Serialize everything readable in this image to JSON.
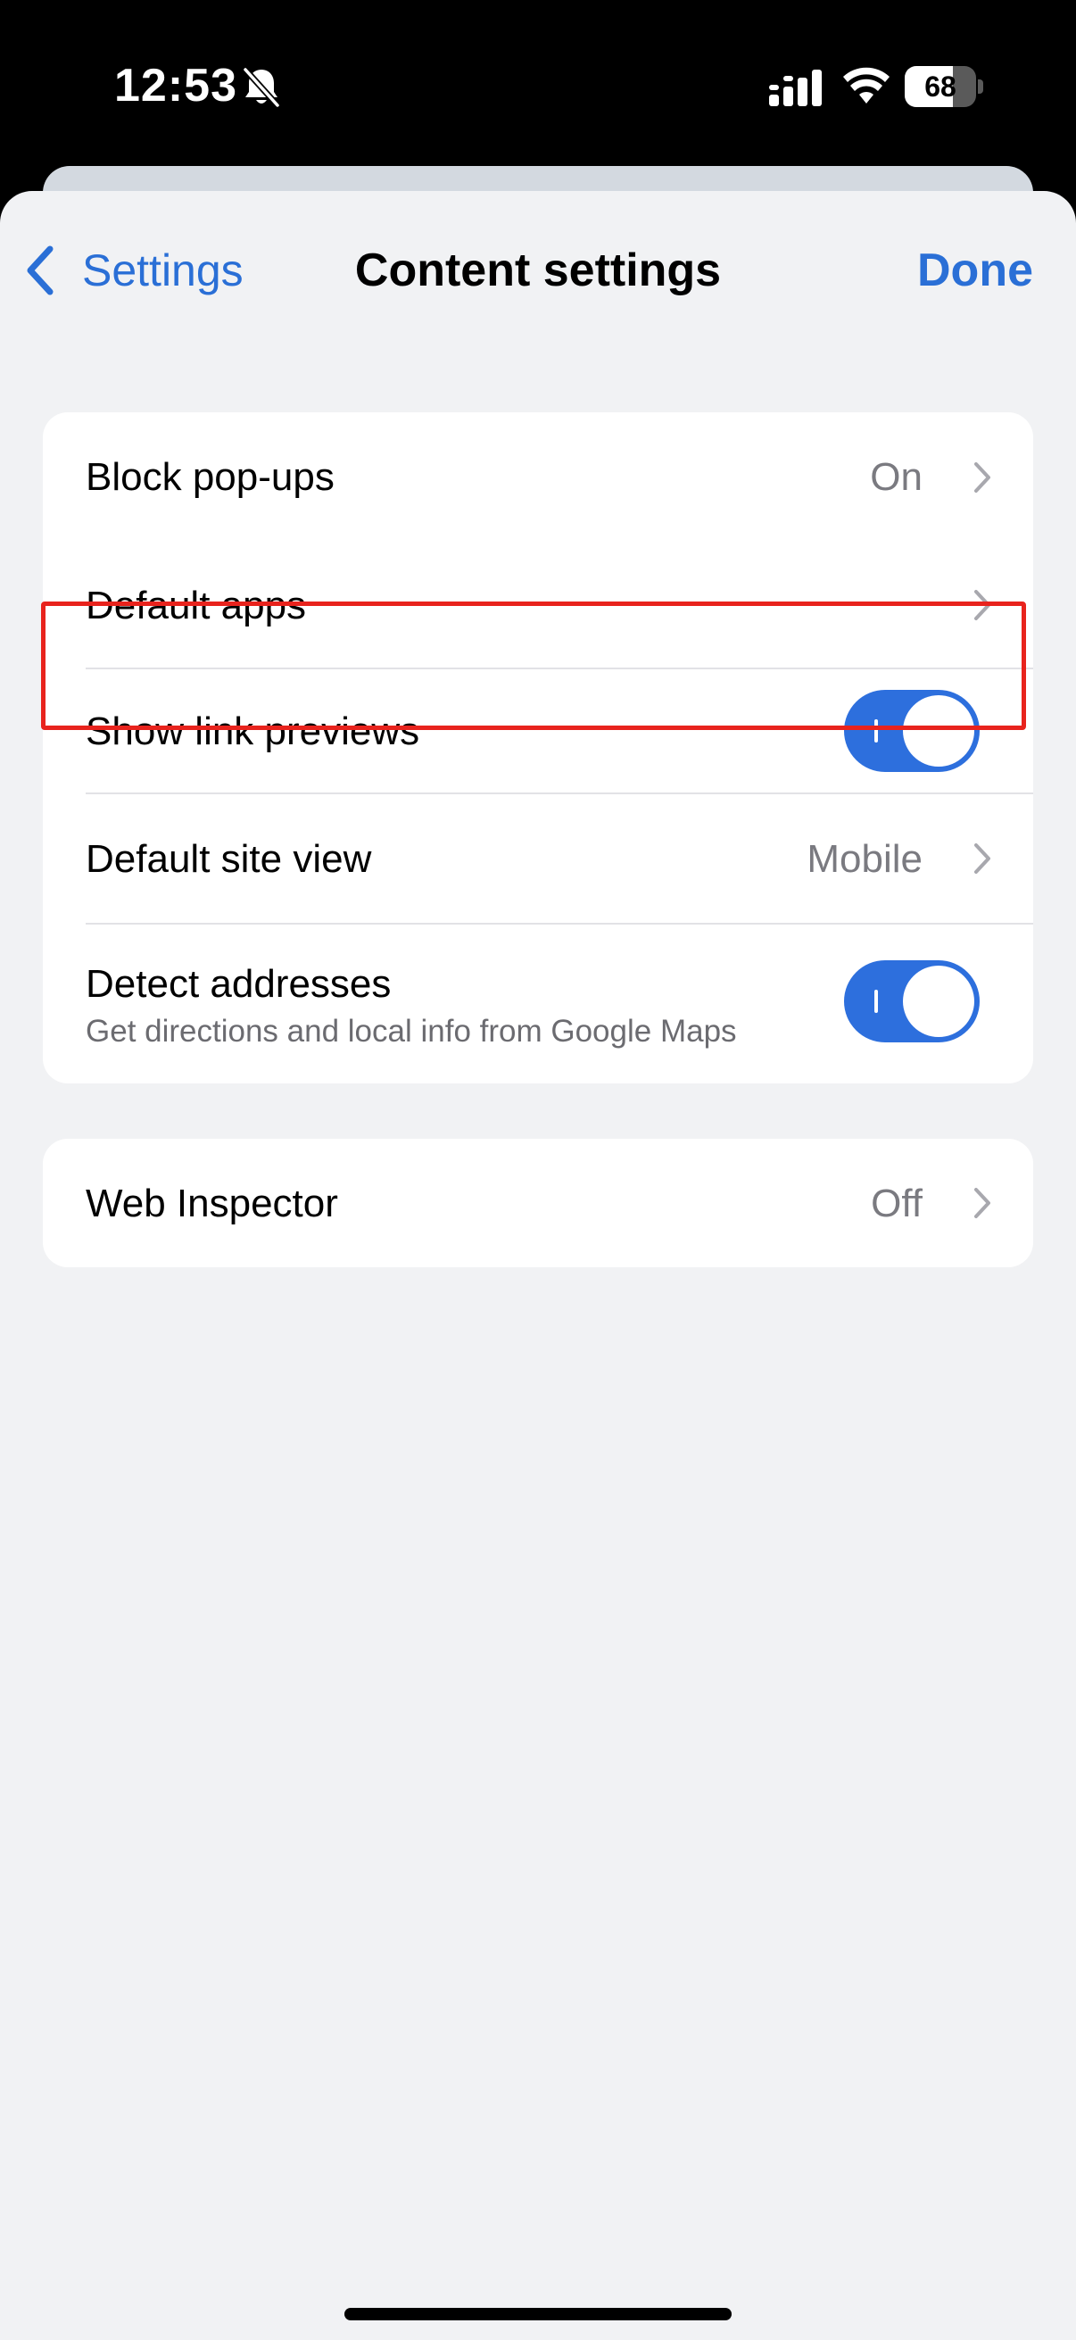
{
  "status_bar": {
    "time": "12:53",
    "battery_level": "68",
    "battery_fraction": 0.68,
    "icons": [
      "bell-slash-icon",
      "signal-icon",
      "wifi-icon",
      "battery-icon"
    ]
  },
  "nav": {
    "back_label": "Settings",
    "title": "Content settings",
    "done_label": "Done"
  },
  "rows": {
    "block_popups": {
      "label": "Block pop-ups",
      "value": "On"
    },
    "default_apps": {
      "label": "Default apps"
    },
    "link_previews": {
      "label": "Show link previews",
      "toggle": "on"
    },
    "site_view": {
      "label": "Default site view",
      "value": "Mobile"
    },
    "detect_addresses": {
      "label": "Detect addresses",
      "sublabel": "Get directions and local info from Google Maps",
      "toggle": "on"
    },
    "web_inspector": {
      "label": "Web Inspector",
      "value": "Off"
    }
  },
  "colors": {
    "accent": "#2a6fd6",
    "toggle_on": "#2d6fdd",
    "highlight": "#e8231d",
    "background": "#f1f2f4"
  }
}
